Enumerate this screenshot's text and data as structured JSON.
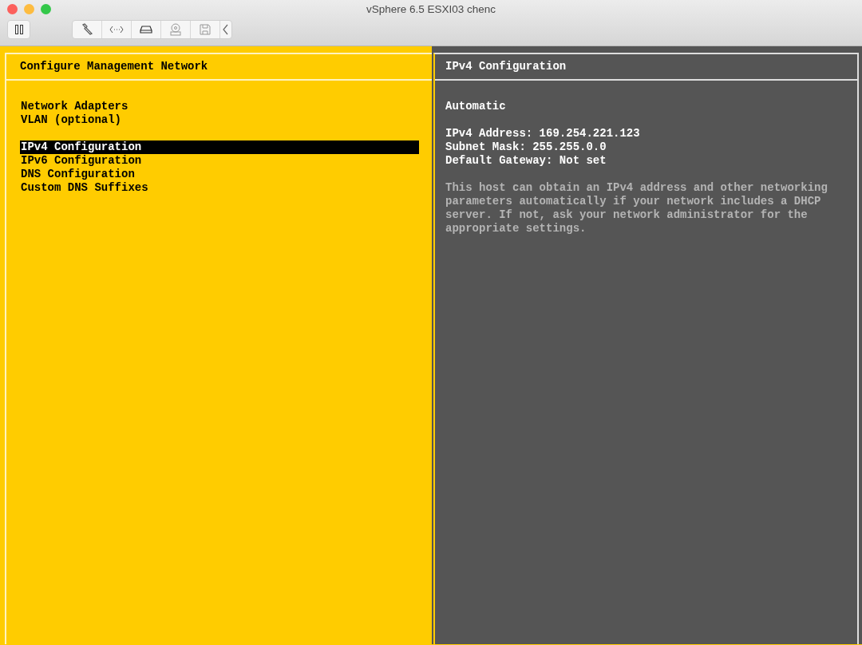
{
  "window": {
    "title": "vSphere 6.5 ESXI03 chenc"
  },
  "left_panel": {
    "title": "Configure Management Network",
    "groups": [
      [
        {
          "label": "Network Adapters",
          "selected": false
        },
        {
          "label": "VLAN (optional)",
          "selected": false
        }
      ],
      [
        {
          "label": "IPv4 Configuration",
          "selected": true
        },
        {
          "label": "IPv6 Configuration",
          "selected": false
        },
        {
          "label": "DNS Configuration",
          "selected": false
        },
        {
          "label": "Custom DNS Suffixes",
          "selected": false
        }
      ]
    ]
  },
  "right_panel": {
    "title": "IPv4 Configuration",
    "mode": "Automatic",
    "details": [
      "IPv4 Address: 169.254.221.123",
      "Subnet Mask: 255.255.0.0",
      "Default Gateway: Not set"
    ],
    "description": "This host can obtain an IPv4 address and other networking parameters automatically if your network includes a DHCP server. If not, ask your network administrator for the appropriate settings."
  }
}
